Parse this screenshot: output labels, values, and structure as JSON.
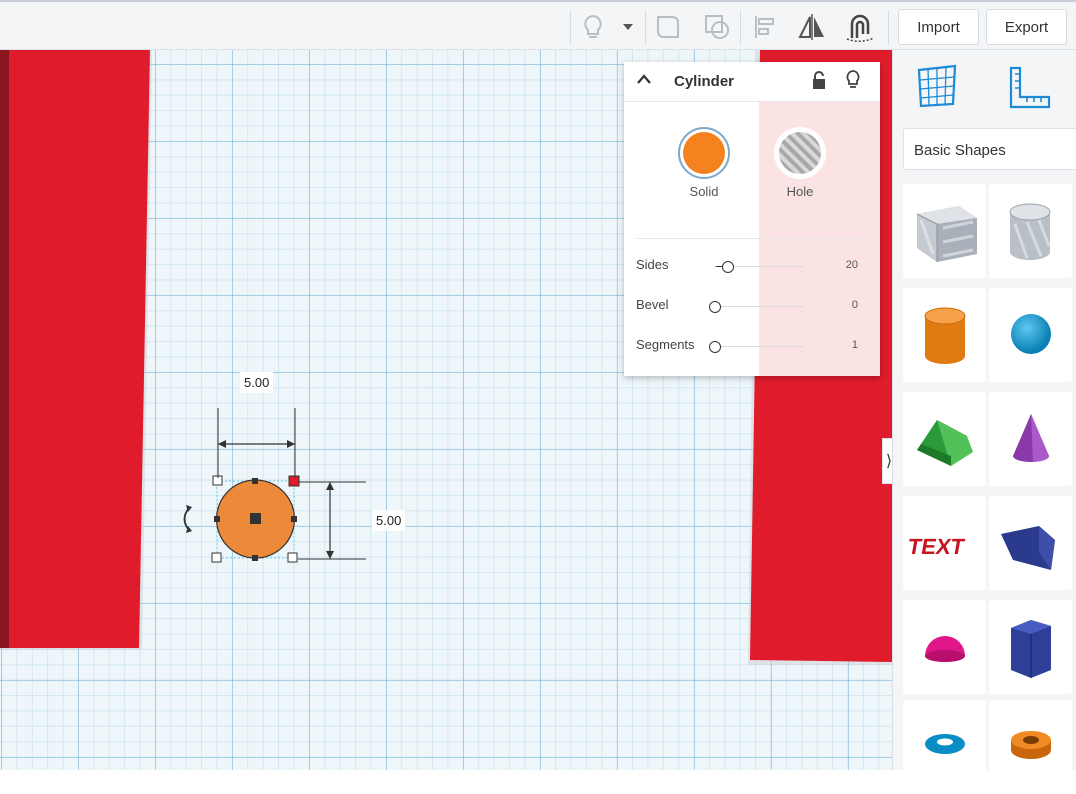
{
  "toolbar": {
    "import_label": "Import",
    "export_label": "Export",
    "icons": [
      "lightbulb-icon",
      "dropdown-arrow-icon",
      "group-icon",
      "ungroup-icon",
      "align-icon",
      "mirror-icon",
      "cruise-icon"
    ]
  },
  "inspector": {
    "title": "Cylinder",
    "solid_label": "Solid",
    "hole_label": "Hole",
    "solid_color": "#f5821f",
    "properties": [
      {
        "label": "Sides",
        "value": "20"
      },
      {
        "label": "Bevel",
        "value": "0"
      },
      {
        "label": "Segments",
        "value": "1"
      }
    ]
  },
  "dimensions": {
    "width": "5.00",
    "depth": "5.00"
  },
  "panel": {
    "category": "Basic Shapes",
    "shapes": [
      "box-hole",
      "cylinder-hole",
      "cylinder",
      "sphere",
      "roof",
      "cone",
      "text",
      "wedge",
      "half-sphere",
      "polygon",
      "torus",
      "tube"
    ]
  },
  "colors": {
    "red_block": "#e01b2c",
    "accent": "#1c8ad6",
    "hole_tint": "#fbe3e3"
  }
}
